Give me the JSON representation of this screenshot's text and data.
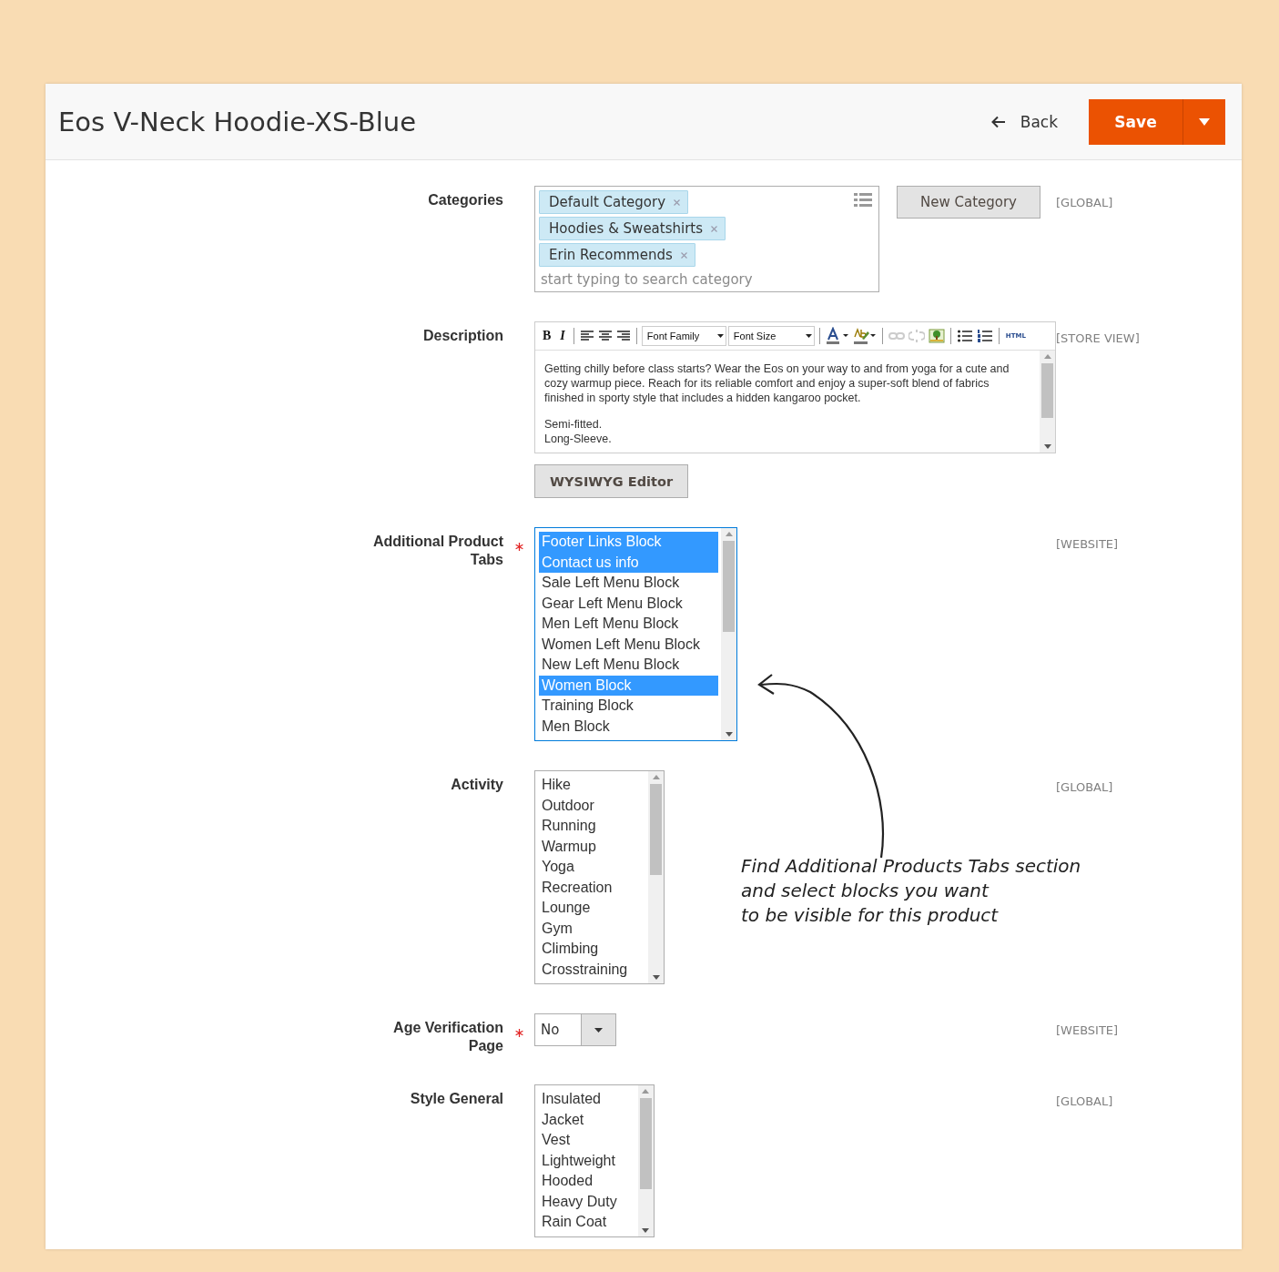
{
  "header": {
    "title": "Eos V-Neck Hoodie-XS-Blue",
    "back": "Back",
    "save": "Save"
  },
  "fields": [
    {
      "kind": "tags",
      "label": "Categories",
      "required": false,
      "scope": "[GLOBAL]",
      "tags": [
        "Default Category",
        "Hoodies & Sweatshirts",
        "Erin Recommends"
      ],
      "placeholder": "start typing to search category",
      "button": "New Category"
    },
    {
      "kind": "editor",
      "label": "Description",
      "required": false,
      "scope": "[STORE VIEW]",
      "toolbar": {
        "bold": "B",
        "italic": "I",
        "font_family": "Font Family",
        "font_size": "Font Size",
        "html": "HTML"
      },
      "paragraphs": [
        "Getting chilly before class starts? Wear the Eos on your way to and from yoga for a cute and cozy warmup piece. Reach for its reliable comfort and enjoy a super-soft blend of fabrics finished in sporty style that includes a hidden kangaroo pocket.",
        "Semi-fitted.",
        "Long-Sleeve."
      ],
      "button": "WYSIWYG Editor"
    },
    {
      "kind": "multiselect",
      "label": "Additional Product Tabs",
      "required": true,
      "focused": true,
      "scope": "[WEBSITE]",
      "options": [
        {
          "label": "Footer Links Block",
          "selected": true
        },
        {
          "label": "Contact us info",
          "selected": true
        },
        {
          "label": "Sale Left Menu Block",
          "selected": false
        },
        {
          "label": "Gear Left Menu Block",
          "selected": false
        },
        {
          "label": "Men Left Menu Block",
          "selected": false
        },
        {
          "label": "Women Left Menu Block",
          "selected": false
        },
        {
          "label": "New Left Menu Block",
          "selected": false
        },
        {
          "label": "Women Block",
          "selected": true
        },
        {
          "label": "Training Block",
          "selected": false
        },
        {
          "label": "Men Block",
          "selected": false
        }
      ]
    },
    {
      "kind": "multiselect",
      "label": "Activity",
      "required": false,
      "focused": false,
      "scope": "[GLOBAL]",
      "options": [
        {
          "label": "Hike",
          "selected": false
        },
        {
          "label": "Outdoor",
          "selected": false
        },
        {
          "label": "Running",
          "selected": false
        },
        {
          "label": "Warmup",
          "selected": false
        },
        {
          "label": "Yoga",
          "selected": false
        },
        {
          "label": "Recreation",
          "selected": false
        },
        {
          "label": "Lounge",
          "selected": false
        },
        {
          "label": "Gym",
          "selected": false
        },
        {
          "label": "Climbing",
          "selected": false
        },
        {
          "label": "Crosstraining",
          "selected": false
        }
      ]
    },
    {
      "kind": "select",
      "label": "Age Verification Page",
      "required": true,
      "value": "No",
      "scope": "[WEBSITE]"
    },
    {
      "kind": "multiselect",
      "label": "Style General",
      "required": false,
      "focused": false,
      "scope": "[GLOBAL]",
      "options": [
        {
          "label": "Insulated",
          "selected": false
        },
        {
          "label": "Jacket",
          "selected": false
        },
        {
          "label": "Vest",
          "selected": false
        },
        {
          "label": "Lightweight",
          "selected": false
        },
        {
          "label": "Hooded",
          "selected": false
        },
        {
          "label": "Heavy Duty",
          "selected": false
        },
        {
          "label": "Rain Coat",
          "selected": false
        }
      ]
    }
  ],
  "annotation": {
    "lines": [
      "Find Additional Products Tabs section",
      "and select blocks you want",
      "to be visible for this product"
    ]
  }
}
